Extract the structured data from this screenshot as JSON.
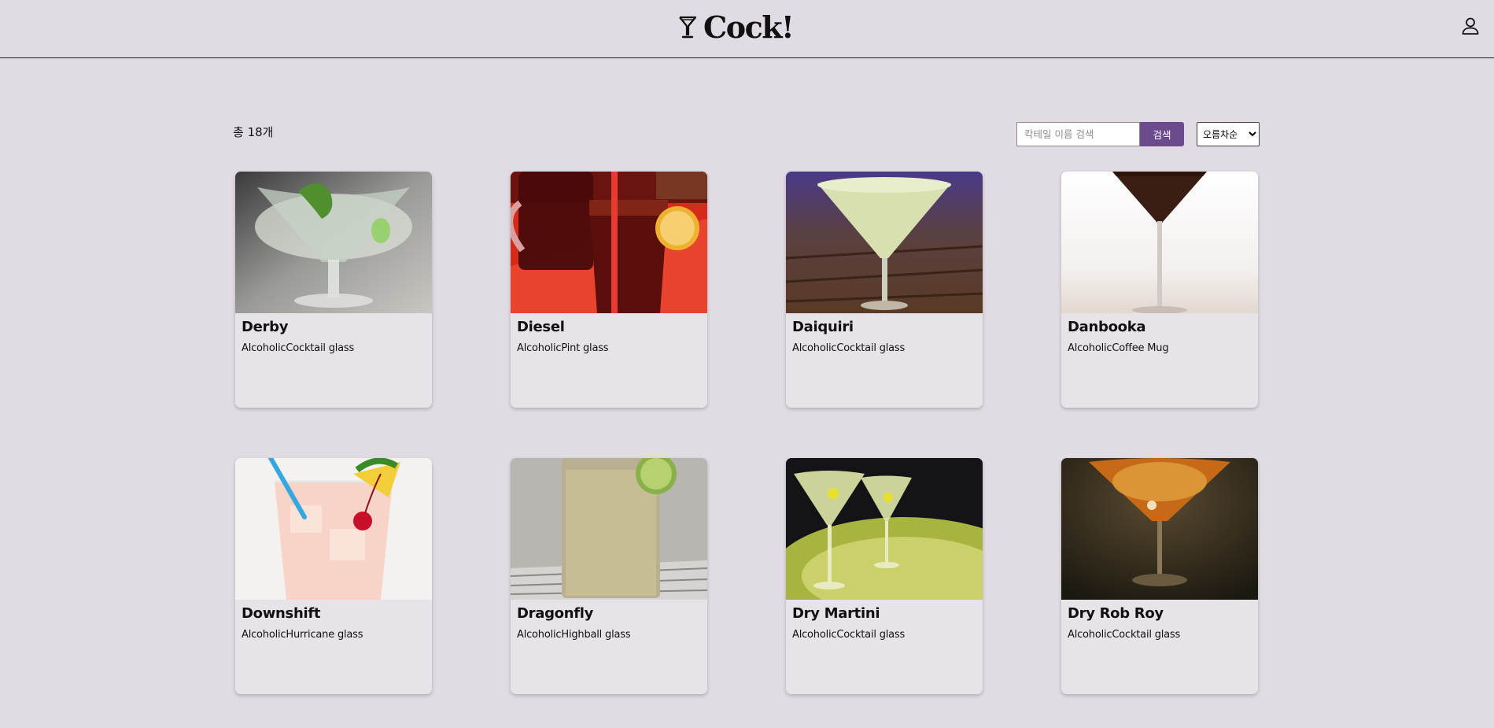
{
  "header": {
    "logo_text": "Cock!"
  },
  "toolbar": {
    "total_count": "총 18개",
    "search_placeholder": "칵테일 이름 검색",
    "search_button": "검색",
    "sort_selected": "오름차순"
  },
  "cocktails": [
    {
      "name": "Derby",
      "category": "Alcoholic",
      "glass": "Cocktail glass"
    },
    {
      "name": "Diesel",
      "category": "Alcoholic",
      "glass": "Pint glass"
    },
    {
      "name": "Daiquiri",
      "category": "Alcoholic",
      "glass": "Cocktail glass"
    },
    {
      "name": "Danbooka",
      "category": "Alcoholic",
      "glass": "Coffee Mug"
    },
    {
      "name": "Downshift",
      "category": "Alcoholic",
      "glass": "Hurricane glass"
    },
    {
      "name": "Dragonfly",
      "category": "Alcoholic",
      "glass": "Highball glass"
    },
    {
      "name": "Dry Martini",
      "category": "Alcoholic",
      "glass": "Cocktail glass"
    },
    {
      "name": "Dry Rob Roy",
      "category": "Alcoholic",
      "glass": "Cocktail glass"
    }
  ],
  "colors": {
    "background": "#e1dce3",
    "accent": "#6b4a8e",
    "card": "#e7e3e8"
  }
}
